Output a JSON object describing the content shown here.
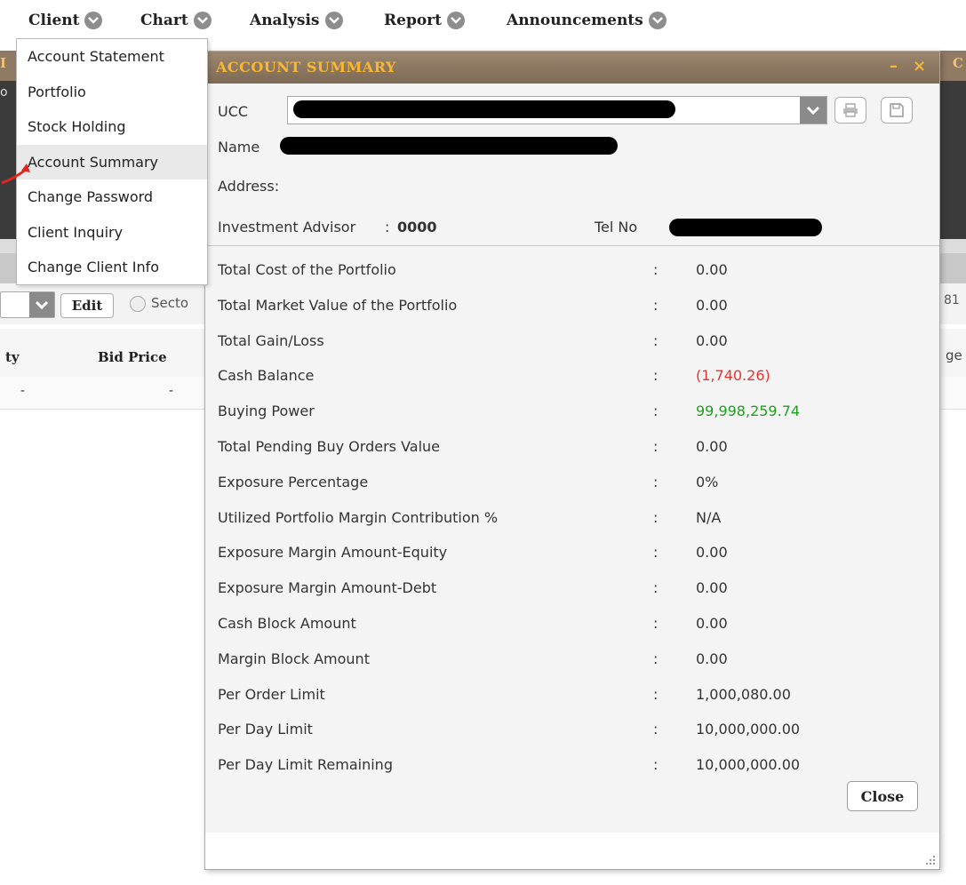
{
  "menu": {
    "items": [
      {
        "label": "Client"
      },
      {
        "label": "Chart"
      },
      {
        "label": "Analysis"
      },
      {
        "label": "Report"
      },
      {
        "label": "Announcements"
      }
    ]
  },
  "client_dropdown": {
    "items": [
      {
        "label": "Account Statement"
      },
      {
        "label": "Portfolio"
      },
      {
        "label": "Stock Holding"
      },
      {
        "label": "Account Summary",
        "active": true
      },
      {
        "label": "Change Password"
      },
      {
        "label": "Client Inquiry"
      },
      {
        "label": "Change Client Info"
      }
    ]
  },
  "background": {
    "edit_label": "Edit",
    "sector_label": "Secto",
    "col_qty_label": "ty",
    "col_bid_label": "Bid Price",
    "col_right_label": "ge",
    "right_number": "81",
    "cell_dash_1": "-",
    "cell_dash_2": "-"
  },
  "modal": {
    "title": "ACCOUNT SUMMARY",
    "minimize_glyph": "–",
    "close_glyph": "×",
    "ucc_label": "UCC",
    "name_label": "Name",
    "address_label": "Address:",
    "advisor_label": "Investment Advisor",
    "advisor_colon": ":",
    "advisor_value": "0000",
    "tel_label": "Tel No",
    "close_button": "Close",
    "value_colors": {
      "negative": "#e8322e",
      "positive": "#1f9e1f"
    },
    "rows": [
      {
        "label": "Total Cost of the Portfolio",
        "value": "0.00"
      },
      {
        "label": "Total Market Value of the Portfolio",
        "value": "0.00"
      },
      {
        "label": "Total Gain/Loss",
        "value": "0.00"
      },
      {
        "label": "Cash Balance",
        "value": "(1,740.26)"
      },
      {
        "label": "Buying Power",
        "value": "99,998,259.74"
      },
      {
        "label": "Total Pending Buy Orders Value",
        "value": "0.00"
      },
      {
        "label": "Exposure Percentage",
        "value": "0%"
      },
      {
        "label": "Utilized Portfolio Margin Contribution %",
        "value": "N/A"
      },
      {
        "label": "Exposure Margin Amount-Equity",
        "value": "0.00"
      },
      {
        "label": "Exposure Margin Amount-Debt",
        "value": "0.00"
      },
      {
        "label": "Cash Block Amount",
        "value": "0.00"
      },
      {
        "label": "Margin Block Amount",
        "value": "0.00"
      },
      {
        "label": "Per Order Limit",
        "value": "1,000,080.00"
      },
      {
        "label": "Per Day Limit",
        "value": "10,000,000.00"
      },
      {
        "label": "Per Day Limit Remaining",
        "value": "10,000,000.00"
      }
    ],
    "colon": ":"
  }
}
